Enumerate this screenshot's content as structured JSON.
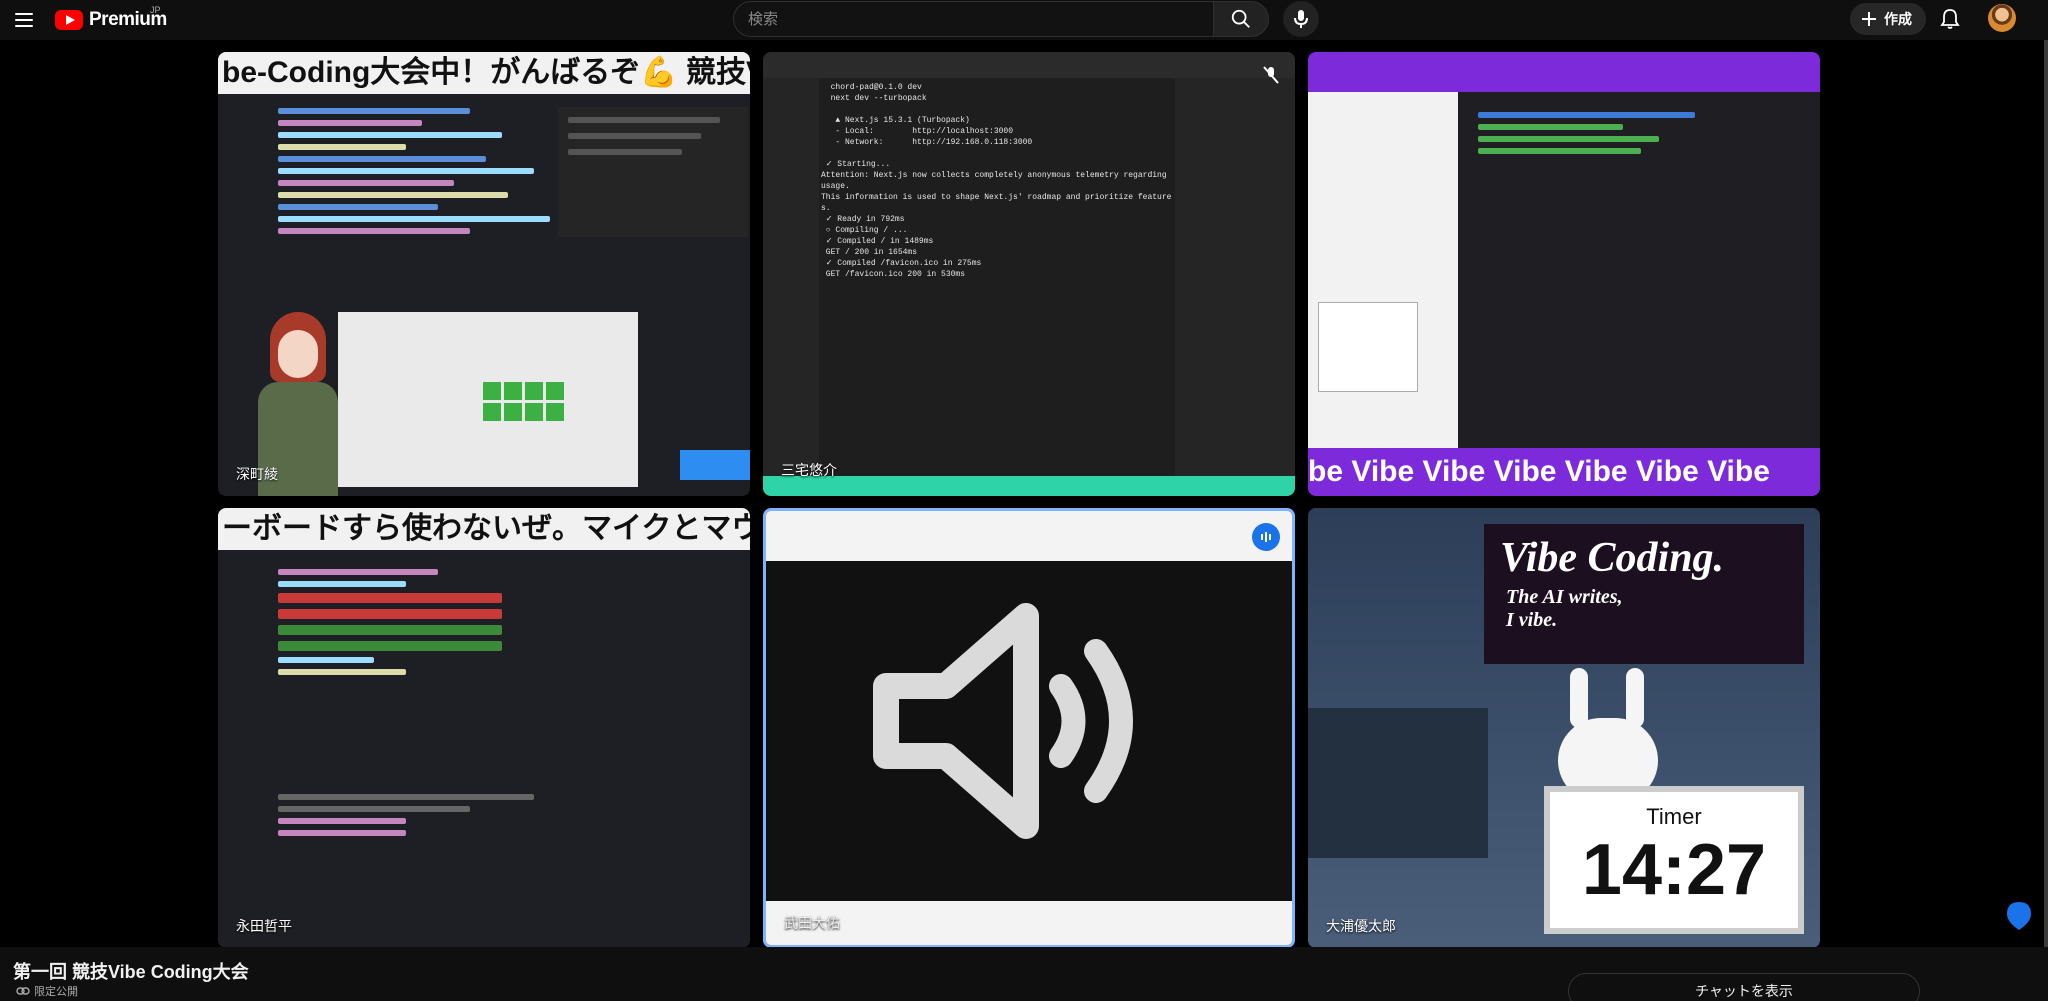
{
  "header": {
    "logo_text": "Premium",
    "logo_region": "JP",
    "search_placeholder": "検索",
    "create_label": "作成"
  },
  "tiles": [
    {
      "name": "深町綾",
      "banner": "be-Coding大会中！がんばるぞ💪 競技Vib"
    },
    {
      "name": "三宅悠介"
    },
    {
      "name": "",
      "banner": "be Vibe Vibe Vibe Vibe Vibe Vibe"
    },
    {
      "name": "永田哲平",
      "banner": "ーボードすら使わないぜ。マイクとマウ"
    },
    {
      "name": "武田大佑"
    },
    {
      "name": "大浦優太郎",
      "title_big": "Vibe Coding.",
      "title_sub1": "The AI writes,",
      "title_sub2": "I vibe.",
      "timer_label": "Timer",
      "timer_value": "14:27"
    }
  ],
  "video": {
    "title": "第一回 競技Vibe Coding大会",
    "privacy": "限定公開"
  },
  "chat": {
    "show_label": "チャットを表示"
  },
  "terminal_lines": "  chord-pad@0.1.0 dev\n  next dev --turbopack\n\n   ▲ Next.js 15.3.1 (Turbopack)\n   - Local:        http://localhost:3000\n   - Network:      http://192.168.0.118:3000\n\n ✓ Starting...\nAttention: Next.js now collects completely anonymous telemetry regarding\nusage.\nThis information is used to shape Next.js' roadmap and prioritize feature\ns.\n ✓ Ready in 792ms\n ○ Compiling / ...\n ✓ Compiled / in 1489ms\n GET / 200 in 1654ms\n ✓ Compiled /favicon.ico in 275ms\n GET /favicon.ico 200 in 530ms"
}
